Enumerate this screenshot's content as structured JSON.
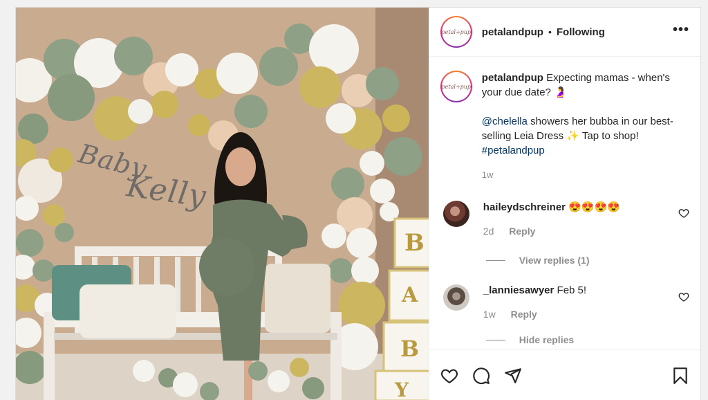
{
  "header": {
    "avatar_text": "petal+pup",
    "username": "petalandpup",
    "separator": "•",
    "follow_status": "Following",
    "more": "•••"
  },
  "photo": {
    "banner_line1": "Baby",
    "banner_line2": "Kelly",
    "blocks": [
      "B",
      "A",
      "B",
      "Y"
    ]
  },
  "caption": {
    "username": "petalandpup",
    "text1": "Expecting mamas - when's your due date? 🤰",
    "mention": "@chelella",
    "text2": "showers her bubba in our best-selling Leia Dress ✨ Tap to shop!",
    "hashtag": "#petalandpup",
    "time": "1w"
  },
  "comments": [
    {
      "username": "haileydschreiner",
      "text": "😍😍😍😍",
      "time": "2d",
      "reply": "Reply"
    },
    {
      "username": "_lanniesawyer",
      "text": "Feb 5!",
      "time": "1w",
      "reply": "Reply"
    }
  ],
  "view_replies": "View replies (1)",
  "hide_replies": "Hide replies",
  "colors": {
    "link": "#00376b",
    "muted": "#8e8e8e",
    "text": "#262626"
  },
  "icons": [
    "more-icon",
    "heart-icon",
    "comment-icon",
    "share-icon",
    "bookmark-icon"
  ]
}
